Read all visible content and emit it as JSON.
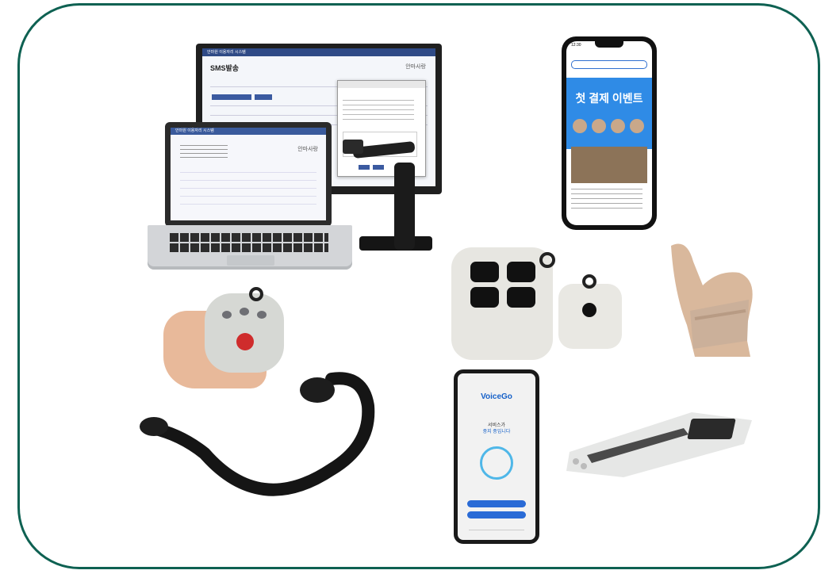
{
  "monitor": {
    "app_title": "안마원 이용자리 시스템",
    "page_title": "SMS발송",
    "logo_text": "안마사랑"
  },
  "laptop": {
    "app_title": "안마원 이용자리 시스템",
    "logo_text": "안마사랑"
  },
  "phone_top": {
    "time": "12:30",
    "event_title": "첫 결제 이벤트"
  },
  "phone_bottom": {
    "brand": "VoiceGo",
    "message_line1": "서비스가",
    "message_line2": "중지 중입니다"
  },
  "colors": {
    "frame": "#0e6152",
    "brand_blue": "#1560c8",
    "banner_blue": "#2f8be6",
    "sos_red": "#cf2c2c"
  }
}
